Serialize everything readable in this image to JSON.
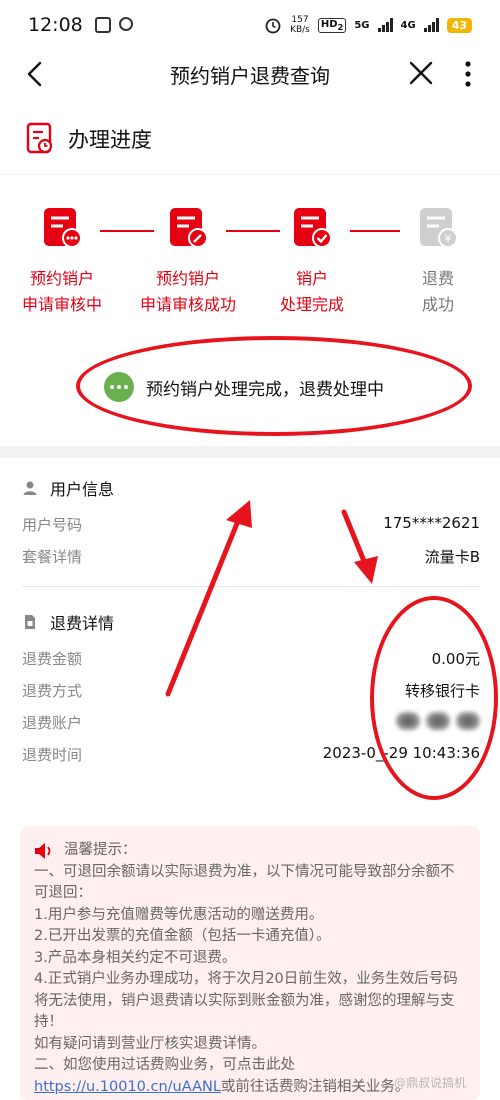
{
  "status_bar": {
    "time": "12:08",
    "speed_value": "157",
    "speed_unit": "KB/s",
    "hd_label": "HD",
    "hd_sub": "2",
    "net1": "5G",
    "net2": "4G",
    "battery": "43"
  },
  "nav": {
    "title": "预约销户退费查询"
  },
  "progress_section": {
    "title": "办理进度"
  },
  "steps": [
    {
      "line1": "预约销户",
      "line2": "申请审核中",
      "state": "done"
    },
    {
      "line1": "预约销户",
      "line2": "申请审核成功",
      "state": "done"
    },
    {
      "line1": "销户",
      "line2": "处理完成",
      "state": "done"
    },
    {
      "line1": "退费",
      "line2": "成功",
      "state": "pending"
    }
  ],
  "status_message": "预约销户处理完成，退费处理中",
  "user_info": {
    "title": "用户信息",
    "rows": [
      {
        "label": "用户号码",
        "value": "175****2621"
      },
      {
        "label": "套餐详情",
        "value": "流量卡B"
      }
    ]
  },
  "refund_info": {
    "title": "退费详情",
    "rows": [
      {
        "label": "退费金额",
        "value": "0.00元"
      },
      {
        "label": "退费方式",
        "value": "转移银行卡"
      },
      {
        "label": "退费账户",
        "value": ""
      },
      {
        "label": "退费时间",
        "value": "2023-0_-29 10:43:36"
      }
    ]
  },
  "notice": {
    "title": "温馨提示：",
    "lines": [
      "一、可退回余额请以实际退费为准，以下情况可能导致部分余额不可退回：",
      "1.用户参与充值赠费等优惠活动的赠送费用。",
      "2.已开出发票的充值金额（包括一卡通充值）。",
      "3.产品本身相关约定不可退费。",
      "4.正式销户业务办理成功，将于次月20日前生效，业务生效后号码将无法使用，销户退费请以实际到账金额为准，感谢您的理解与支持！",
      "如有疑问请到营业厅核实退费详情。",
      "二、如您使用过话费购业务，可点击此处"
    ],
    "link": "https://u.10010.cn/uAANL",
    "link_tail": "或前往话费购注销相关业务。"
  },
  "watermark": "@鼎叔说搞机"
}
